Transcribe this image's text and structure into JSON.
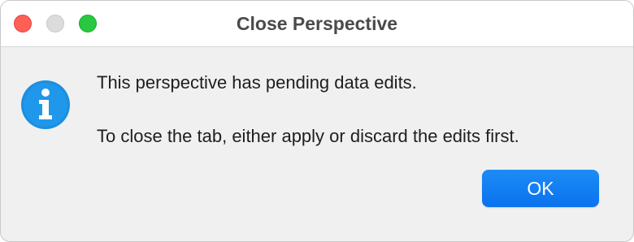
{
  "window": {
    "title": "Close Perspective"
  },
  "dialog": {
    "icon": "info-icon",
    "message_line1": "This perspective has pending data edits.",
    "message_line2": "To close the tab, either apply or discard the edits first.",
    "ok_label": "OK"
  },
  "colors": {
    "accent": "#0a72ee",
    "info_icon": "#1a8fe0",
    "close_light": "#fe5f57",
    "maximize_light": "#28c840"
  }
}
